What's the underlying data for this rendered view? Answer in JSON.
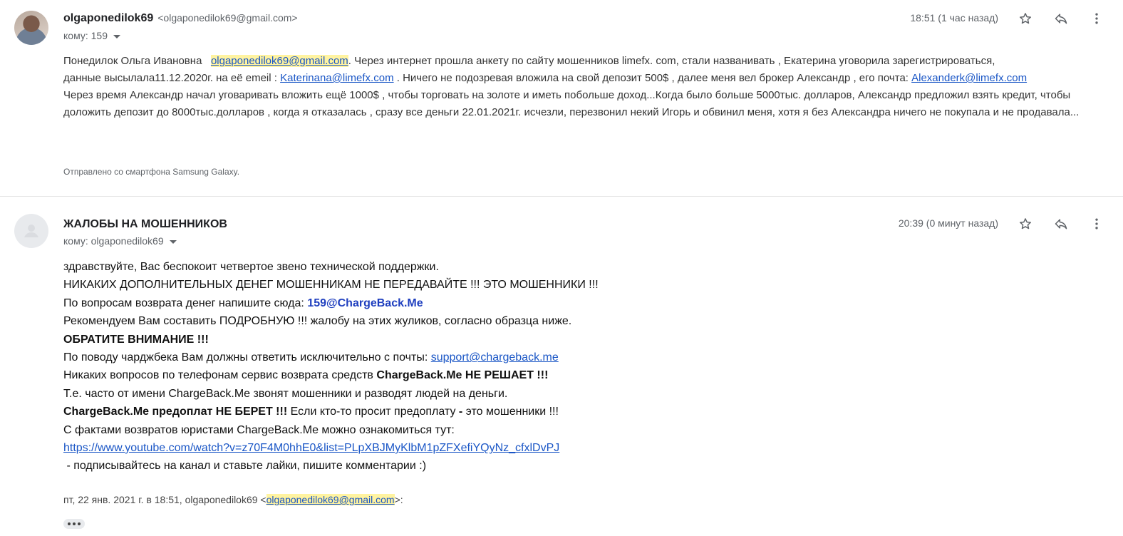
{
  "message1": {
    "sender_name": "olgaponedilok69",
    "sender_email": "<olgaponedilok69@gmail.com>",
    "recipient": "кому: 159",
    "timestamp": "18:51 (1 час назад)",
    "body": {
      "p1_a": "Понедилок Ольга Ивановна",
      "p1_email": "olgaponedilok69@gmail.com",
      "p1_b": ". Через интернет прошла анкету по сайту мошенников limefx. com, стали названивать , Екатерина уговорила зарегистрироваться,",
      "p2_a": "данные высылала11.12.2020г.  на её emeil :",
      "p2_link1": "Katerinana@limefx.com",
      "p2_b": ". Ничего не подозревая вложила на свой депозит 500$ , далее меня вел брокер Александр , его почта:",
      "p2_link2": "Alexanderk@limefx.com",
      "p3": "Через время Александр  начал уговаривать вложить ещё 1000$ , чтобы торговать на золоте и иметь побольше доход...Когда было больше 5000тыс. долларов, Александр предложил взять кредит, чтобы доложить депозит до 8000тыс.долларов , когда я отказалась , сразу все деньги  22.01.2021г. исчезли, перезвонил некий Игорь и обвинил меня, хотя я без Александра  ничего не покупала и не продавала..."
    },
    "signature": "Отправлено со смартфона Samsung Galaxy."
  },
  "message2": {
    "sender_name": "ЖАЛОБЫ НА МОШЕННИКОВ",
    "recipient": "кому: olgaponedilok69",
    "timestamp": "20:39 (0 минут назад)",
    "body": {
      "l1": "здравствуйте, Вас беспокоит четвертое звено технической поддержки.",
      "l2": "НИКАКИХ ДОПОЛНИТЕЛЬНЫХ ДЕНЕГ МОШЕННИКАМ НЕ ПЕРЕДАВАЙТЕ !!! ЭТО МОШЕННИКИ !!!",
      "l3_a": "По вопросам возврата денег напишите сюда:",
      "l3_b": "159@ChargeBack.Me",
      "l4": "Рекомендуем Вам составить ПОДРОБНУЮ !!! жалобу на этих жуликов, согласно образца ниже.",
      "l5": "ОБРАТИТЕ ВНИМАНИЕ !!!",
      "l6_a": "По поводу чарджбека Вам должны ответить исключительно с почты:",
      "l6_link": "support@chargeback.me",
      "l7_a": "Никаких вопросов по телефонам сервис возврата средств",
      "l7_b": "ChargeBack.Me НЕ РЕШАЕТ !!!",
      "l8": "Т.е. часто от имени ChargeBack.Me звонят мошенники и разводят людей на деньги.",
      "l9_a": "ChargeBack.Me предоплат НЕ БЕРЕТ !!!",
      "l9_b": "Если кто-то просит предоплату",
      "l9_c": "-",
      "l9_d": "это мошенники !!!",
      "l10": "С фактами возвратов юристами ChargeBack.Me можно ознакомиться тут:",
      "l11_link": "https://www.youtube.com/watch?v=z70F4M0hhE0&list=PLpXBJMyKlbM1pZFXefiYQyNz_cfxlDvPJ",
      "l12": " - подписывайтесь на канал и ставьте лайки, пишите комментарии :)"
    },
    "quote_prefix": "пт, 22 янв. 2021 г. в 18:51, olgaponedilok69 <",
    "quote_email": "olgaponedilok69@gmail.com",
    "quote_suffix": ">:"
  },
  "icons": [
    "star-icon",
    "reply-icon",
    "more-vert-icon",
    "person-icon",
    "chevron-down-icon",
    "show-trimmed-content-icon"
  ]
}
